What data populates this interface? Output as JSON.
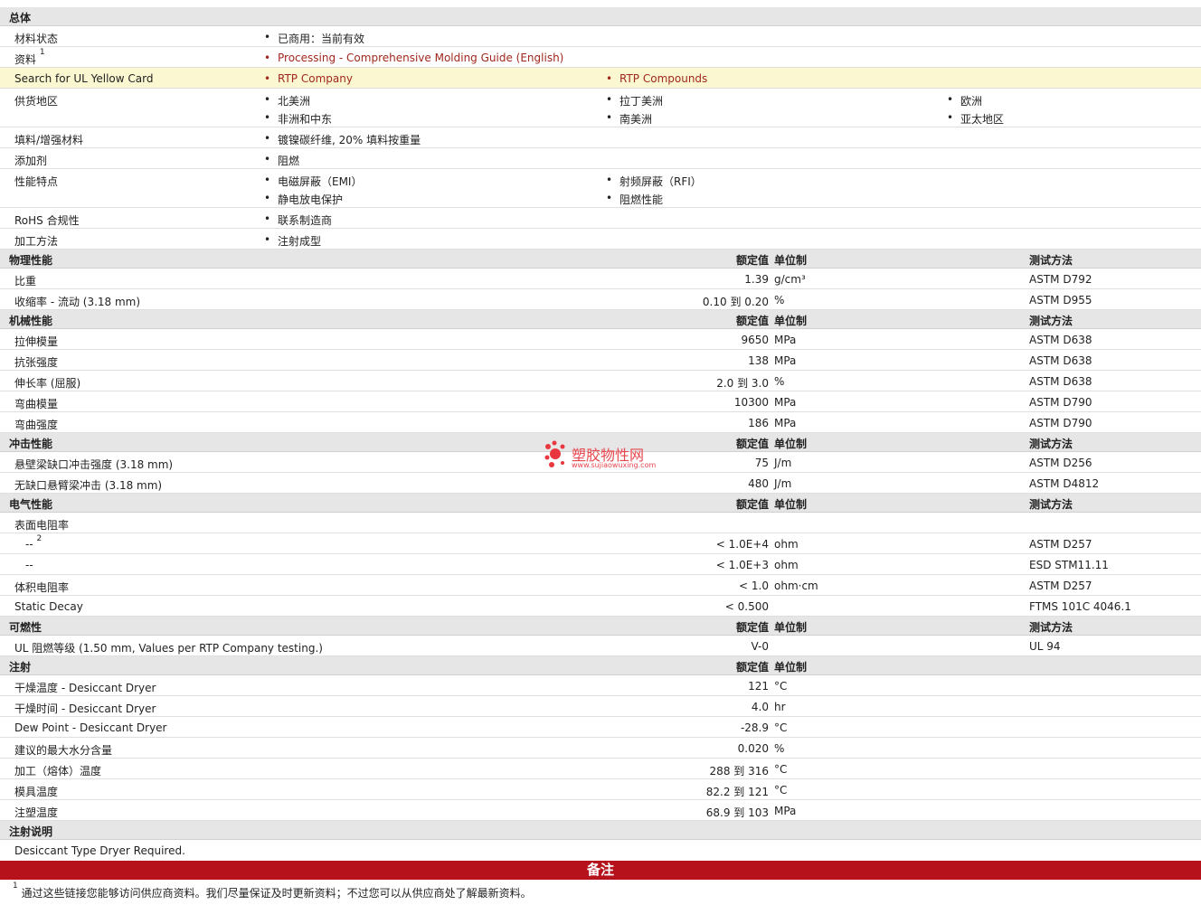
{
  "general": {
    "title": "总体",
    "rows": {
      "status_label": "材料状态",
      "status_value": "已商用：当前有效",
      "docs_label": "资料",
      "docs_sup": "1",
      "docs_link": "Processing - Comprehensive Molding Guide (English)",
      "ul_label": "Search for UL Yellow Card",
      "ul_link1": "RTP Company",
      "ul_link2": "RTP Compounds",
      "region_label": "供货地区",
      "regions": [
        "北美洲",
        "拉丁美洲",
        "欧洲",
        "非洲和中东",
        "南美洲",
        "亚太地区"
      ],
      "filler_label": "填料/增强材料",
      "filler_value": "镀镍碳纤维, 20% 填料按重量",
      "additive_label": "添加剂",
      "additive_value": "阻燃",
      "features_label": "性能特点",
      "features": [
        "电磁屏蔽（EMI）",
        "射频屏蔽（RFI）",
        "静电放电保护",
        "阻燃性能"
      ],
      "rohs_label": "RoHS 合规性",
      "rohs_value": "联系制造商",
      "process_label": "加工方法",
      "process_value": "注射成型"
    }
  },
  "col_headers": {
    "value": "额定值",
    "unit": "单位制",
    "test": "测试方法"
  },
  "physical": {
    "title": "物理性能",
    "rows": [
      {
        "label": "比重",
        "value": "1.39",
        "unit": "g/cm³",
        "test": "ASTM D792"
      },
      {
        "label": "收缩率  - 流动  (3.18 mm)",
        "value": "0.10 到  0.20",
        "unit": "%",
        "test": "ASTM D955"
      }
    ]
  },
  "mechanical": {
    "title": "机械性能",
    "rows": [
      {
        "label": "拉伸模量",
        "value": "9650",
        "unit": "MPa",
        "test": "ASTM D638"
      },
      {
        "label": "抗张强度",
        "value": "138",
        "unit": "MPa",
        "test": "ASTM D638"
      },
      {
        "label": "伸长率  (屈服)",
        "value": "2.0 到  3.0",
        "unit": "%",
        "test": "ASTM D638"
      },
      {
        "label": "弯曲模量",
        "value": "10300",
        "unit": "MPa",
        "test": "ASTM D790"
      },
      {
        "label": "弯曲强度",
        "value": "186",
        "unit": "MPa",
        "test": "ASTM D790"
      }
    ]
  },
  "impact": {
    "title": "冲击性能",
    "rows": [
      {
        "label": "悬壁梁缺口冲击强度  (3.18 mm)",
        "value": "75",
        "unit": "J/m",
        "test": "ASTM D256"
      },
      {
        "label": "无缺口悬臂梁冲击  (3.18 mm)",
        "value": "480",
        "unit": "J/m",
        "test": "ASTM D4812"
      }
    ]
  },
  "electrical": {
    "title": "电气性能",
    "surface_label": "表面电阻率",
    "sub1_label": "--",
    "sub1_sup": "2",
    "sub1_value": "< 1.0E+4",
    "sub1_unit": "ohm",
    "sub1_test": "ASTM D257",
    "sub2_label": "--",
    "sub2_value": "< 1.0E+3",
    "sub2_unit": "ohm",
    "sub2_test": "ESD STM11.11",
    "vol_label": "体积电阻率",
    "vol_value": "< 1.0",
    "vol_unit": "ohm·cm",
    "vol_test": "ASTM D257",
    "decay_label": "Static Decay",
    "decay_value": "< 0.500",
    "decay_test": "FTMS 101C 4046.1"
  },
  "flammability": {
    "title": "可燃性",
    "rows": [
      {
        "label": "UL 阻燃等级  (1.50 mm, Values per RTP Company testing.)",
        "value": "V-0",
        "unit": "",
        "test": "UL 94"
      }
    ]
  },
  "injection": {
    "title": "注射",
    "rows": [
      {
        "label": "干燥温度  - Desiccant Dryer",
        "value": "121",
        "unit": "°C"
      },
      {
        "label": "干燥时间  - Desiccant Dryer",
        "value": "4.0",
        "unit": "hr"
      },
      {
        "label": "Dew Point - Desiccant Dryer",
        "value": "-28.9",
        "unit": "°C"
      },
      {
        "label": "建议的最大水分含量",
        "value": "0.020",
        "unit": "%"
      },
      {
        "label": "加工（熔体）温度",
        "value": "288 到  316",
        "unit": "°C"
      },
      {
        "label": "模具温度",
        "value": "82.2 到  121",
        "unit": "°C"
      },
      {
        "label": "注塑温度",
        "value": "68.9 到  103",
        "unit": "MPa"
      }
    ]
  },
  "injection_notes": {
    "title": "注射说明",
    "text": "Desiccant Type Dryer Required."
  },
  "notes": {
    "title": "备注",
    "footnote_sup": "1",
    "footnote": "通过这些链接您能够访问供应商资料。我们尽量保证及时更新资料；不过您可以从供应商处了解最新资料。"
  },
  "watermark": {
    "name": "塑胶物性网",
    "url": "www.sujiaowuxing.com"
  }
}
